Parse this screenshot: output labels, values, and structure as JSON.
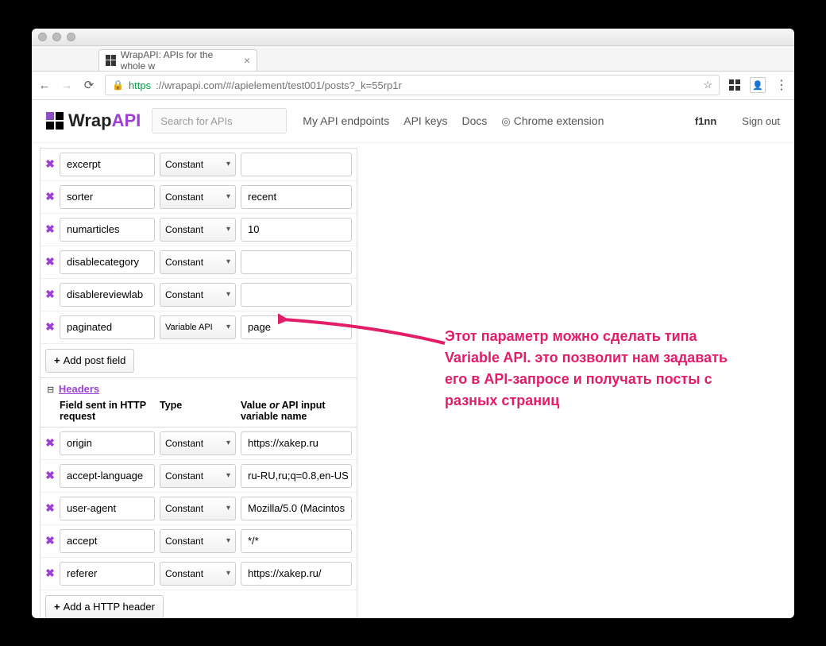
{
  "browser": {
    "tab_title": "WrapAPI: APIs for the whole w",
    "url_https": "https",
    "url_host": "://wrapapi.com",
    "url_path": "/#/apielement/test001/posts?_k=55rp1r"
  },
  "app": {
    "logo_wrap": "Wrap",
    "logo_api": "API",
    "search_placeholder": "Search for APIs",
    "nav": {
      "endpoints": "My API endpoints",
      "keys": "API keys",
      "docs": "Docs",
      "ext": "Chrome extension"
    },
    "user": "f1nn",
    "signout": "Sign out"
  },
  "post_fields": [
    {
      "name": "excerpt",
      "type": "Constant",
      "value": ""
    },
    {
      "name": "sorter",
      "type": "Constant",
      "value": "recent"
    },
    {
      "name": "numarticles",
      "type": "Constant",
      "value": "10"
    },
    {
      "name": "disablecategory",
      "type": "Constant",
      "value": ""
    },
    {
      "name": "disablereviewlab",
      "type": "Constant",
      "value": ""
    },
    {
      "name": "paginated",
      "type": "Variable API",
      "value": "page"
    }
  ],
  "add_post_label": "Add post field",
  "headers_section": {
    "title": "Headers",
    "col_field": "Field sent in HTTP request",
    "col_type": "Type",
    "col_value_pre": "Value ",
    "col_value_em": "or",
    "col_value_post": " API input variable name"
  },
  "headers": [
    {
      "name": "origin",
      "type": "Constant",
      "value": "https://xakep.ru"
    },
    {
      "name": "accept-language",
      "type": "Constant",
      "value": "ru-RU,ru;q=0.8,en-US"
    },
    {
      "name": "user-agent",
      "type": "Constant",
      "value": "Mozilla/5.0 (Macintos"
    },
    {
      "name": "accept",
      "type": "Constant",
      "value": "*/*"
    },
    {
      "name": "referer",
      "type": "Constant",
      "value": "https://xakep.ru/"
    }
  ],
  "add_header_label": "Add a HTTP header",
  "annotation": "Этот параметр можно сделать типа Variable API. это позволит нам задавать его в API-запросе и получать посты с разных страниц"
}
